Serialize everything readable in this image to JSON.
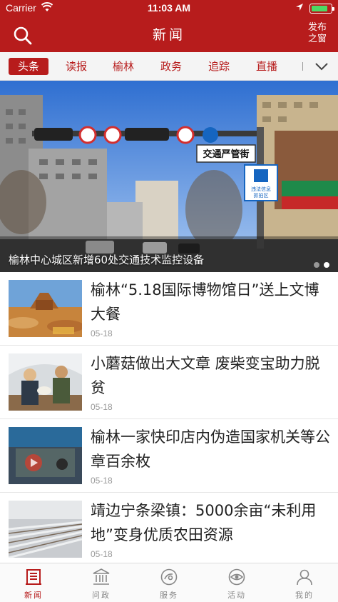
{
  "status_bar": {
    "carrier": "Carrier",
    "time": "11:03 AM"
  },
  "nav": {
    "title": "新闻",
    "publish_line1": "发布",
    "publish_line2": "之窗",
    "search_icon": "search-icon"
  },
  "tabs": [
    {
      "label": "头条",
      "active": true
    },
    {
      "label": "读报",
      "active": false
    },
    {
      "label": "榆林",
      "active": false
    },
    {
      "label": "政务",
      "active": false
    },
    {
      "label": "追踪",
      "active": false
    },
    {
      "label": "直播",
      "active": false
    }
  ],
  "hero": {
    "caption": "榆林中心城区新增60处交通技术监控设备",
    "sign_text": "交通严管街",
    "sign2_line1": "违法信息",
    "sign2_line2": "抓拍区"
  },
  "news": [
    {
      "title": "榆林“5.18国际博物馆日”送上文博大餐",
      "date": "05-18"
    },
    {
      "title": "小蘑菇做出大文章 废柴变宝助力脱贫",
      "date": "05-18"
    },
    {
      "title": "榆林一家快印店内伪造国家机关等公章百余枚",
      "date": "05-18"
    },
    {
      "title": "靖边宁条梁镇：5000余亩“未利用地”变身优质农田资源",
      "date": "05-18"
    }
  ],
  "tabbar": [
    {
      "label": "新闻",
      "icon": "newspaper-icon",
      "active": true
    },
    {
      "label": "问政",
      "icon": "government-icon",
      "active": false
    },
    {
      "label": "服务",
      "icon": "service-icon",
      "active": false
    },
    {
      "label": "活动",
      "icon": "activity-icon",
      "active": false
    },
    {
      "label": "我的",
      "icon": "profile-icon",
      "active": false
    }
  ],
  "colors": {
    "brand": "#b71c1c",
    "tab_bg": "#f4f4f4"
  }
}
